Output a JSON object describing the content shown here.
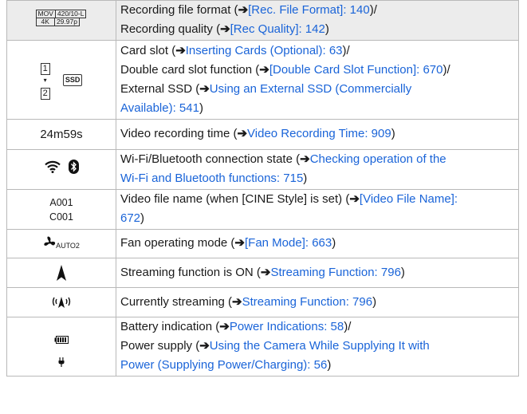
{
  "rows": [
    {
      "icon": {
        "type": "mov",
        "cells": [
          [
            "MOV",
            "420/10-L"
          ],
          [
            "4K",
            "29.97p"
          ]
        ]
      },
      "lines": [
        [
          {
            "t": "Recording file format ("
          },
          {
            "t": "➔",
            "arrow": true
          },
          {
            "t": "[Rec. File Format]: 140",
            "link": true
          },
          {
            "t": ")/"
          }
        ],
        [
          {
            "t": "Recording quality ("
          },
          {
            "t": "➔",
            "arrow": true
          },
          {
            "t": "[Rec Quality]: 142",
            "link": true
          },
          {
            "t": ")"
          }
        ]
      ]
    },
    {
      "icon": {
        "type": "slots",
        "slot1": "1",
        "slot2": "2",
        "ssd": "SSD"
      },
      "lines": [
        [
          {
            "t": "Card slot ("
          },
          {
            "t": "➔",
            "arrow": true
          },
          {
            "t": "Inserting Cards (Optional): 63",
            "link": true
          },
          {
            "t": ")/"
          }
        ],
        [
          {
            "t": "Double card slot function ("
          },
          {
            "t": "➔",
            "arrow": true
          },
          {
            "t": "[Double Card Slot Function]: 670",
            "link": true
          },
          {
            "t": ")/"
          }
        ],
        [
          {
            "t": "External SSD ("
          },
          {
            "t": "➔",
            "arrow": true
          },
          {
            "t": "Using an External SSD (Commercially",
            "link": true
          }
        ],
        [
          {
            "t": "Available): 541",
            "link": true
          },
          {
            "t": ")"
          }
        ]
      ]
    },
    {
      "icon": {
        "type": "text",
        "text": "24m59s"
      },
      "lines": [
        [
          {
            "t": "Video recording time ("
          },
          {
            "t": "➔",
            "arrow": true
          },
          {
            "t": "Video Recording Time: 909",
            "link": true
          },
          {
            "t": ")"
          }
        ]
      ]
    },
    {
      "icon": {
        "type": "wifi-bt"
      },
      "lines": [
        [
          {
            "t": "Wi-Fi/Bluetooth connection state ("
          },
          {
            "t": "➔",
            "arrow": true
          },
          {
            "t": "Checking operation of the",
            "link": true
          }
        ],
        [
          {
            "t": "Wi-Fi and Bluetooth functions: 715",
            "link": true
          },
          {
            "t": ")"
          }
        ]
      ]
    },
    {
      "icon": {
        "type": "filename",
        "line1": "A001",
        "line2": "C001"
      },
      "lines": [
        [
          {
            "t": "Video file name (when [CINE Style] is set) ("
          },
          {
            "t": "➔",
            "arrow": true
          },
          {
            "t": "[Video File Name]:",
            "link": true
          }
        ],
        [
          {
            "t": "672",
            "link": true
          },
          {
            "t": ")"
          }
        ]
      ]
    },
    {
      "icon": {
        "type": "fan",
        "sub": "AUTO2"
      },
      "lines": [
        [
          {
            "t": "Fan operating mode ("
          },
          {
            "t": "➔",
            "arrow": true
          },
          {
            "t": "[Fan Mode]: 663",
            "link": true
          },
          {
            "t": ")"
          }
        ]
      ]
    },
    {
      "icon": {
        "type": "stream-on"
      },
      "lines": [
        [
          {
            "t": "Streaming function is ON ("
          },
          {
            "t": "➔",
            "arrow": true
          },
          {
            "t": "Streaming Function: 796",
            "link": true
          },
          {
            "t": ")"
          }
        ]
      ]
    },
    {
      "icon": {
        "type": "streaming"
      },
      "lines": [
        [
          {
            "t": "Currently streaming ("
          },
          {
            "t": "➔",
            "arrow": true
          },
          {
            "t": "Streaming Function: 796",
            "link": true
          },
          {
            "t": ")"
          }
        ]
      ]
    },
    {
      "icon": {
        "type": "battery"
      },
      "lines": [
        [
          {
            "t": "Battery indication ("
          },
          {
            "t": "➔",
            "arrow": true
          },
          {
            "t": "Power Indications: 58",
            "link": true
          },
          {
            "t": ")/"
          }
        ],
        [
          {
            "t": "Power supply ("
          },
          {
            "t": "➔",
            "arrow": true
          },
          {
            "t": "Using the Camera While Supplying It with",
            "link": true
          }
        ],
        [
          {
            "t": "Power (Supplying Power/Charging): 56",
            "link": true
          },
          {
            "t": ")"
          }
        ]
      ]
    }
  ]
}
